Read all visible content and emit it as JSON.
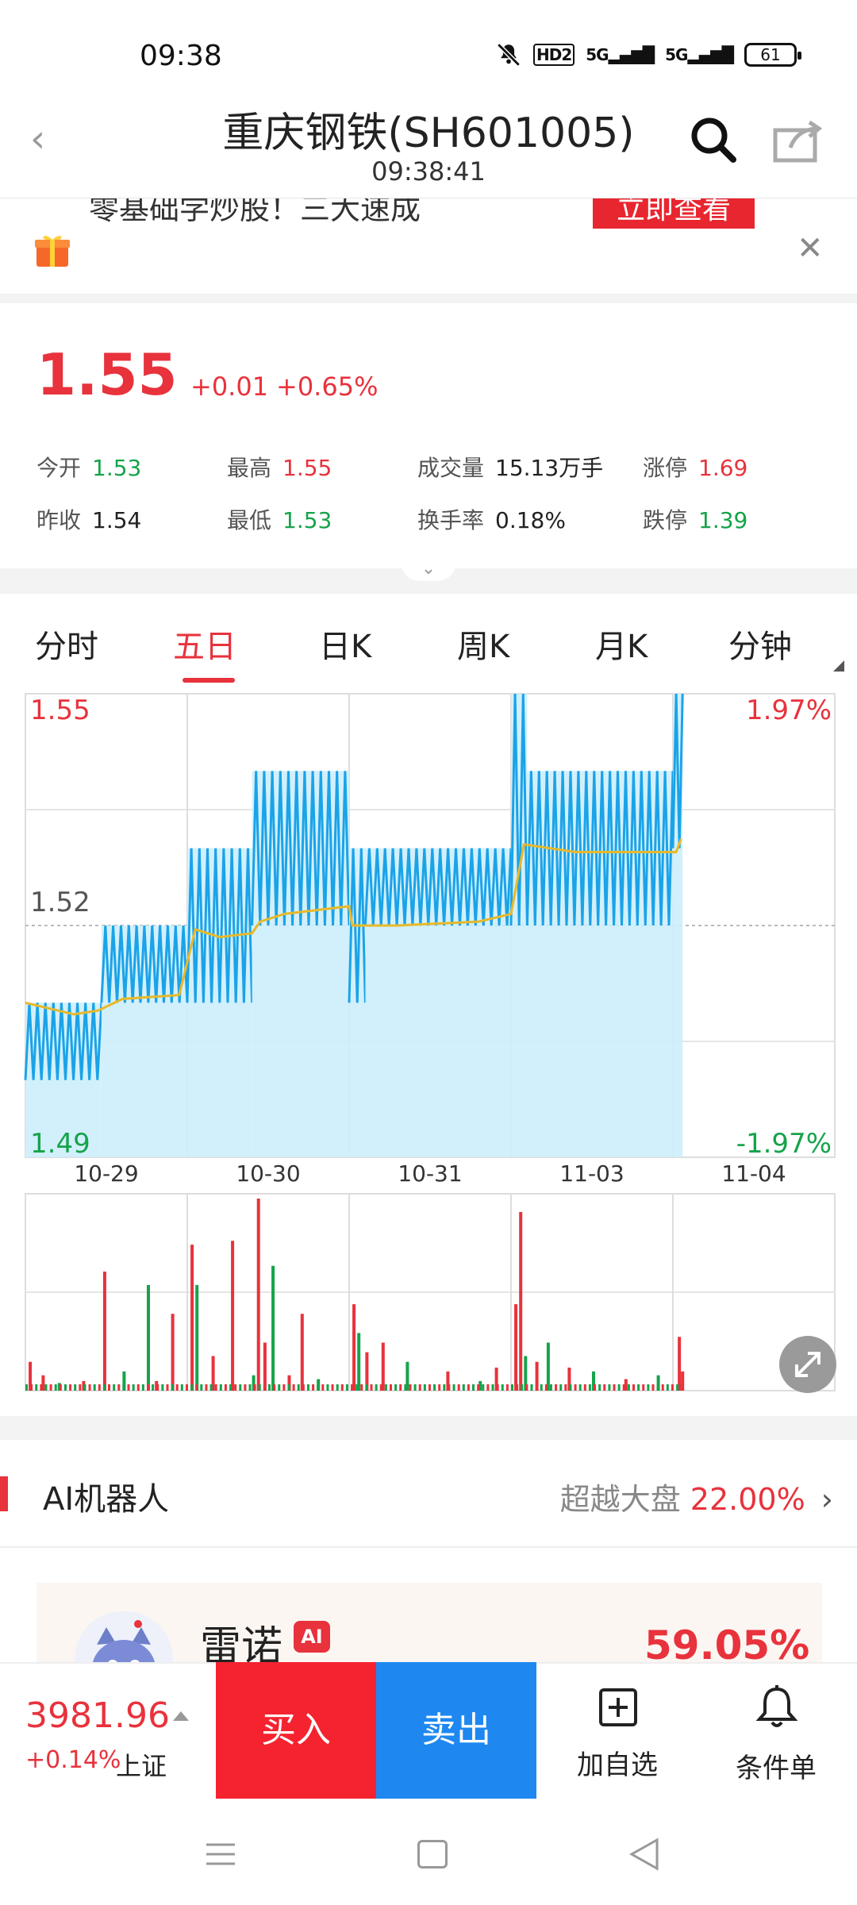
{
  "status_bar": {
    "time": "09:38",
    "battery": "61",
    "hd": "HD2",
    "net1": "5G",
    "net2": "5G"
  },
  "header": {
    "title": "重庆钢铁(SH601005)",
    "time": "09:38:41"
  },
  "banner": {
    "text": "零基础学炒股！三大速成",
    "button": "立即查看"
  },
  "quote": {
    "price": "1.55",
    "change": "+0.01",
    "change_pct": "+0.65%",
    "stats": [
      {
        "label": "今开",
        "value": "1.53",
        "color": "#16a34a"
      },
      {
        "label": "最高",
        "value": "1.55",
        "color": "#e8323c"
      },
      {
        "label": "成交量",
        "value": "15.13万手",
        "color": "#222222"
      },
      {
        "label": "涨停",
        "value": "1.69",
        "color": "#e8323c"
      },
      {
        "label": "昨收",
        "value": "1.54",
        "color": "#222222"
      },
      {
        "label": "最低",
        "value": "1.53",
        "color": "#16a34a"
      },
      {
        "label": "换手率",
        "value": "0.18%",
        "color": "#222222"
      },
      {
        "label": "跌停",
        "value": "1.39",
        "color": "#16a34a"
      }
    ]
  },
  "tabs": [
    {
      "label": "分时",
      "active": false
    },
    {
      "label": "五日",
      "active": true
    },
    {
      "label": "日K",
      "active": false
    },
    {
      "label": "周K",
      "active": false
    },
    {
      "label": "月K",
      "active": false
    },
    {
      "label": "分钟",
      "active": false
    }
  ],
  "chart_data": {
    "type": "line",
    "title": "",
    "y_left_labels": {
      "top": "1.55",
      "mid": "1.52",
      "bottom": "1.49"
    },
    "y_right_labels": {
      "top": "1.97%",
      "bottom": "-1.97%"
    },
    "ylim": [
      1.49,
      1.55
    ],
    "prev_close": 1.52,
    "dates": [
      "10-29",
      "10-30",
      "10-31",
      "11-03",
      "11-04"
    ],
    "series": [
      {
        "kind": "price_band",
        "color": "#1ba3e8",
        "segments": [
          {
            "day": 0,
            "start": 0.0,
            "end": 0.47,
            "low": 1.5,
            "high": 1.51
          },
          {
            "day": 0,
            "start": 0.47,
            "end": 1.0,
            "low": 1.51,
            "high": 1.52
          },
          {
            "day": 1,
            "start": 0.0,
            "end": 0.4,
            "low": 1.51,
            "high": 1.53
          },
          {
            "day": 1,
            "start": 0.4,
            "end": 1.0,
            "low": 1.52,
            "high": 1.54
          },
          {
            "day": 2,
            "start": 0.0,
            "end": 0.1,
            "low": 1.51,
            "high": 1.53
          },
          {
            "day": 2,
            "start": 0.1,
            "end": 1.0,
            "low": 1.52,
            "high": 1.53
          },
          {
            "day": 3,
            "start": 0.0,
            "end": 0.1,
            "low": 1.52,
            "high": 1.55
          },
          {
            "day": 3,
            "start": 0.1,
            "end": 1.0,
            "low": 1.52,
            "high": 1.54
          },
          {
            "day": 4,
            "start": 0.0,
            "end": 0.06,
            "low": 1.53,
            "high": 1.55
          }
        ]
      },
      {
        "kind": "avg",
        "color": "#e8b92a",
        "points": [
          [
            0.0,
            1.51
          ],
          [
            0.3,
            1.5085
          ],
          [
            0.45,
            1.509
          ],
          [
            0.6,
            1.5105
          ],
          [
            0.95,
            1.511
          ],
          [
            1.05,
            1.5195
          ],
          [
            1.2,
            1.5185
          ],
          [
            1.4,
            1.519
          ],
          [
            1.45,
            1.5205
          ],
          [
            1.6,
            1.5215
          ],
          [
            2.0,
            1.5225
          ],
          [
            2.02,
            1.52
          ],
          [
            2.3,
            1.52
          ],
          [
            2.8,
            1.5205
          ],
          [
            3.0,
            1.5215
          ],
          [
            3.08,
            1.5305
          ],
          [
            3.4,
            1.5295
          ],
          [
            4.02,
            1.5295
          ],
          [
            4.05,
            1.5312
          ]
        ]
      }
    ],
    "volume": {
      "max": 100,
      "up_color": "#e8323c",
      "down_color": "#16a34a",
      "bars": [
        [
          0.02,
          15,
          1
        ],
        [
          0.1,
          8,
          1
        ],
        [
          0.2,
          4,
          0
        ],
        [
          0.35,
          5,
          1
        ],
        [
          0.48,
          62,
          1
        ],
        [
          0.6,
          10,
          0
        ],
        [
          0.75,
          55,
          0
        ],
        [
          0.8,
          5,
          1
        ],
        [
          0.9,
          40,
          1
        ],
        [
          1.02,
          76,
          1
        ],
        [
          1.05,
          55,
          0
        ],
        [
          1.15,
          18,
          1
        ],
        [
          1.27,
          78,
          1
        ],
        [
          1.4,
          8,
          0
        ],
        [
          1.43,
          100,
          1
        ],
        [
          1.47,
          25,
          1
        ],
        [
          1.52,
          65,
          0
        ],
        [
          1.62,
          8,
          1
        ],
        [
          1.7,
          40,
          1
        ],
        [
          1.8,
          6,
          0
        ],
        [
          2.02,
          45,
          1
        ],
        [
          2.05,
          30,
          0
        ],
        [
          2.1,
          20,
          1
        ],
        [
          2.2,
          25,
          1
        ],
        [
          2.35,
          15,
          0
        ],
        [
          2.6,
          10,
          1
        ],
        [
          2.8,
          5,
          0
        ],
        [
          2.9,
          12,
          1
        ],
        [
          3.02,
          45,
          1
        ],
        [
          3.05,
          93,
          1
        ],
        [
          3.08,
          18,
          0
        ],
        [
          3.15,
          15,
          1
        ],
        [
          3.22,
          25,
          0
        ],
        [
          3.35,
          12,
          1
        ],
        [
          3.5,
          10,
          0
        ],
        [
          3.7,
          6,
          1
        ],
        [
          3.9,
          8,
          0
        ],
        [
          4.03,
          28,
          1
        ],
        [
          4.05,
          10,
          1
        ]
      ]
    }
  },
  "ai_section": {
    "title": "AI机器人",
    "compare_label": "超越大盘",
    "compare_value": "22.00%",
    "robot_name": "雷诺",
    "ai_badge": "AI",
    "robot_value": "59.05%"
  },
  "bottom_bar": {
    "index_value": "3981.96",
    "index_change": "+0.14%",
    "index_name": "上证",
    "buy_label": "买入",
    "sell_label": "卖出",
    "add_watch_label": "加自选",
    "condition_label": "条件单"
  },
  "icons": [
    "back-icon",
    "search-icon",
    "share-icon",
    "gift-icon",
    "close-icon",
    "collapse-chevron-icon",
    "expand-icon",
    "chevron-right-icon",
    "add-watch-icon",
    "bell-icon",
    "mute-icon",
    "battery-icon"
  ]
}
